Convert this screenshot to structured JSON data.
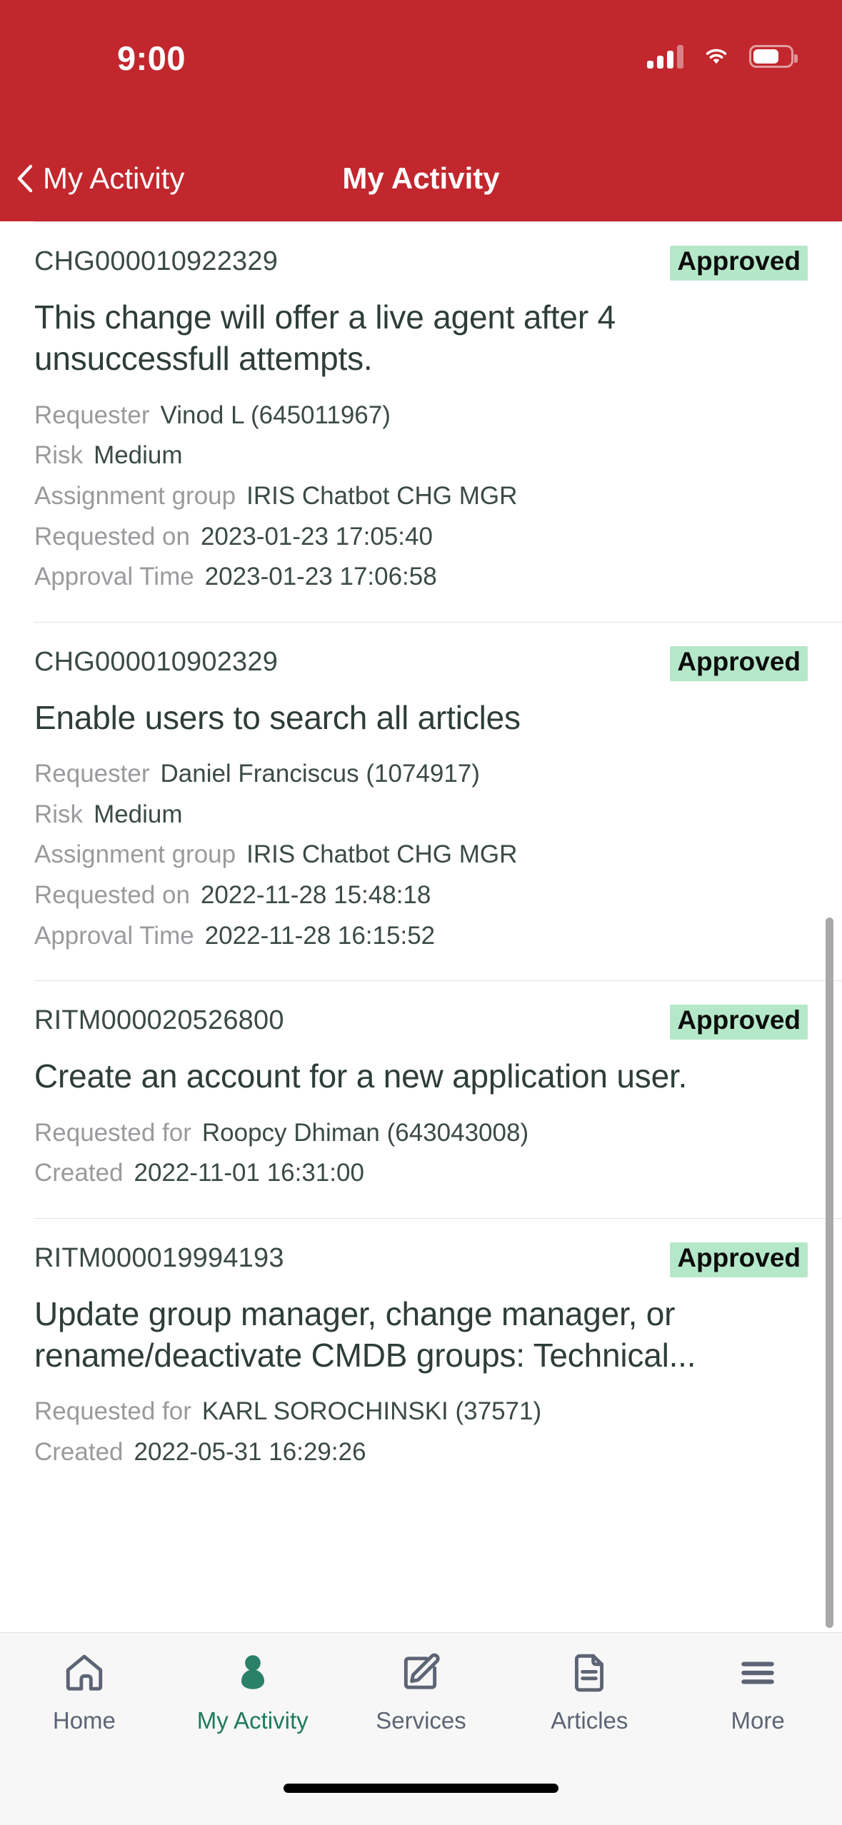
{
  "status_bar": {
    "time": "9:00",
    "cellular_icon": "cellular-signal-icon",
    "cellular_bars_filled": 3,
    "cellular_bars_total": 4,
    "wifi_icon": "wifi-icon",
    "battery_icon": "battery-icon",
    "battery_level_percent": 70
  },
  "header": {
    "background_color": "#c1272d",
    "back_icon": "chevron-left-icon",
    "back_label": "My Activity",
    "title": "My Activity"
  },
  "theme": {
    "brand_red": "#c1272d",
    "badge_green_bg": "#b5e8c9",
    "active_tab_color": "#1f7a5e",
    "inactive_tab_color": "#5d6474",
    "text_primary": "#2e3d3a",
    "text_muted": "#9a9a9e"
  },
  "list": {
    "scrollbar_visible": true,
    "cards": [
      {
        "number": "CHG000010922329",
        "status": "Approved",
        "title": "This change will offer a live agent after 4 unsuccessfull attempts.",
        "meta": [
          {
            "label": "Requester",
            "value": "Vinod L (645011967)"
          },
          {
            "label": "Risk",
            "value": "Medium"
          },
          {
            "label": "Assignment group",
            "value": "IRIS Chatbot CHG MGR"
          },
          {
            "label": "Requested on",
            "value": "2023-01-23 17:05:40"
          },
          {
            "label": "Approval Time",
            "value": "2023-01-23 17:06:58"
          }
        ]
      },
      {
        "number": "CHG000010902329",
        "status": "Approved",
        "title": "Enable users to search all articles",
        "meta": [
          {
            "label": "Requester",
            "value": "Daniel Franciscus (1074917)"
          },
          {
            "label": "Risk",
            "value": "Medium"
          },
          {
            "label": "Assignment group",
            "value": "IRIS Chatbot CHG MGR"
          },
          {
            "label": "Requested on",
            "value": "2022-11-28 15:48:18"
          },
          {
            "label": "Approval Time",
            "value": "2022-11-28 16:15:52"
          }
        ]
      },
      {
        "number": "RITM000020526800",
        "status": "Approved",
        "title": "Create an account for a new application user.",
        "meta": [
          {
            "label": "Requested for",
            "value": "Roopcy Dhiman (643043008)"
          },
          {
            "label": "Created",
            "value": "2022-11-01 16:31:00"
          }
        ]
      },
      {
        "number": "RITM000019994193",
        "status": "Approved",
        "title": "Update group manager, change manager, or rename/deactivate CMDB groups: Technical...",
        "meta": [
          {
            "label": "Requested for",
            "value": "KARL SOROCHINSKI (37571)"
          },
          {
            "label": "Created",
            "value": "2022-05-31 16:29:26"
          }
        ]
      }
    ]
  },
  "tab_bar": {
    "active_index": 1,
    "tabs": [
      {
        "label": "Home",
        "icon": "home-icon"
      },
      {
        "label": "My Activity",
        "icon": "person-icon"
      },
      {
        "label": "Services",
        "icon": "pencil-square-icon"
      },
      {
        "label": "Articles",
        "icon": "document-icon"
      },
      {
        "label": "More",
        "icon": "hamburger-menu-icon"
      }
    ]
  }
}
